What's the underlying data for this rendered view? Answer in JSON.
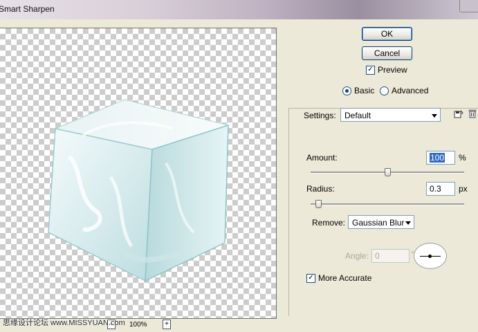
{
  "window": {
    "title": "Smart Sharpen"
  },
  "buttons": {
    "ok": "OK",
    "cancel": "Cancel"
  },
  "preview": {
    "label": "Preview",
    "checked": true
  },
  "mode": {
    "basic": "Basic",
    "advanced": "Advanced",
    "selected": "basic"
  },
  "settings": {
    "label": "Settings:",
    "value": "Default",
    "save_icon": "save-settings-icon",
    "delete_icon": "trash-icon"
  },
  "amount": {
    "label": "Amount:",
    "value": "100",
    "unit": "%",
    "slider_fraction": 0.5
  },
  "radius": {
    "label": "Radius:",
    "value": "0.3",
    "unit": "px",
    "slider_fraction": 0.03
  },
  "remove": {
    "label": "Remove:",
    "value": "Gaussian Blur"
  },
  "angle": {
    "label": "Angle:",
    "value": "0",
    "unit": "°"
  },
  "more_accurate": {
    "label": "More Accurate",
    "checked": true
  },
  "zoom": {
    "minus": "-",
    "level": "100%",
    "plus": "+"
  },
  "watermark": {
    "text": "思缘设计论坛 www.MISSYUAN.com"
  },
  "colors": {
    "accent": "#003c74",
    "face": "#ece9d8"
  }
}
